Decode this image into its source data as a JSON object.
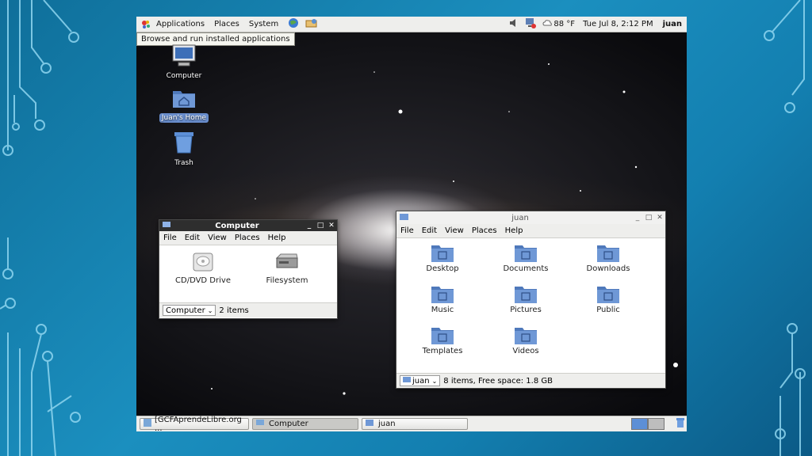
{
  "topbar": {
    "menus": [
      "Applications",
      "Places",
      "System"
    ],
    "weather": "88 °F",
    "datetime": "Tue Jul  8,  2:12 PM",
    "user": "juan",
    "tooltip": "Browse and run installed applications"
  },
  "desktop_icons": [
    {
      "label": "Computer",
      "icon": "computer-icon"
    },
    {
      "label": "Juan's Home",
      "icon": "home-folder-icon",
      "selected": true
    },
    {
      "label": "Trash",
      "icon": "trash-icon"
    }
  ],
  "computer_window": {
    "title": "Computer",
    "menu": [
      "File",
      "Edit",
      "View",
      "Places",
      "Help"
    ],
    "items": [
      {
        "label": "CD/DVD Drive",
        "icon": "optical-drive-icon"
      },
      {
        "label": "Filesystem",
        "icon": "hard-drive-icon"
      }
    ],
    "location": "Computer",
    "status": "2 items"
  },
  "home_window": {
    "title": "juan",
    "menu": [
      "File",
      "Edit",
      "View",
      "Places",
      "Help"
    ],
    "folders": [
      {
        "label": "Desktop",
        "icon": "desktop-folder-icon"
      },
      {
        "label": "Documents",
        "icon": "documents-folder-icon"
      },
      {
        "label": "Downloads",
        "icon": "downloads-folder-icon"
      },
      {
        "label": "Music",
        "icon": "music-folder-icon"
      },
      {
        "label": "Pictures",
        "icon": "pictures-folder-icon"
      },
      {
        "label": "Public",
        "icon": "public-folder-icon"
      },
      {
        "label": "Templates",
        "icon": "templates-folder-icon"
      },
      {
        "label": "Videos",
        "icon": "videos-folder-icon"
      }
    ],
    "location": "juan",
    "status": "8 items, Free space: 1.8 GB"
  },
  "taskbar": [
    {
      "label": "[GCFAprendeLibre.org ...",
      "active": false
    },
    {
      "label": "Computer",
      "active": true
    },
    {
      "label": "juan",
      "active": false
    }
  ],
  "colors": {
    "folder": "#6f98d6",
    "folder_dark": "#4f79bb",
    "panel": "#eeeeec"
  }
}
